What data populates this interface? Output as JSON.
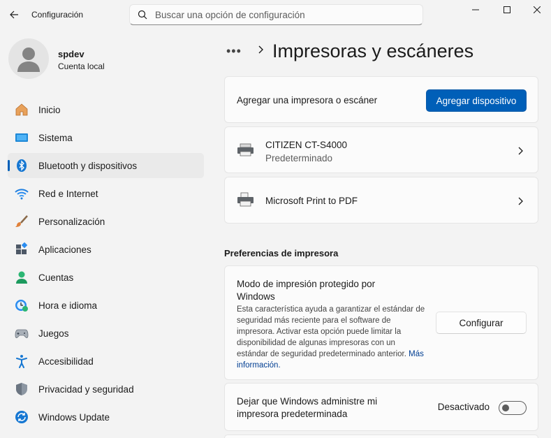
{
  "window": {
    "title": "Configuración",
    "search_placeholder": "Buscar una opción de configuración"
  },
  "profile": {
    "name": "spdev",
    "account_type": "Cuenta local"
  },
  "sidebar": {
    "items": [
      {
        "label": "Inicio",
        "icon": "home-icon"
      },
      {
        "label": "Sistema",
        "icon": "system-icon"
      },
      {
        "label": "Bluetooth y dispositivos",
        "icon": "bluetooth-icon",
        "active": true
      },
      {
        "label": "Red e Internet",
        "icon": "wifi-icon"
      },
      {
        "label": "Personalización",
        "icon": "brush-icon"
      },
      {
        "label": "Aplicaciones",
        "icon": "apps-icon"
      },
      {
        "label": "Cuentas",
        "icon": "account-icon"
      },
      {
        "label": "Hora e idioma",
        "icon": "time-language-icon"
      },
      {
        "label": "Juegos",
        "icon": "gamepad-icon"
      },
      {
        "label": "Accesibilidad",
        "icon": "accessibility-icon"
      },
      {
        "label": "Privacidad y seguridad",
        "icon": "shield-icon"
      },
      {
        "label": "Windows Update",
        "icon": "update-icon"
      }
    ]
  },
  "breadcrumb": {
    "more": "•••",
    "title": "Impresoras y escáneres"
  },
  "add_device": {
    "label": "Agregar una impresora o escáner",
    "button": "Agregar dispositivo"
  },
  "printers": [
    {
      "name": "CITIZEN CT-S4000",
      "status": "Predeterminado"
    },
    {
      "name": "Microsoft Print to PDF",
      "status": ""
    }
  ],
  "preferences": {
    "section_title": "Preferencias de impresora",
    "protected_mode": {
      "title": "Modo de impresión protegido por Windows",
      "description": "Esta característica ayuda a garantizar el estándar de seguridad más reciente para el software de impresora. Activar esta opción puede limitar la disponibilidad de algunas impresoras con un estándar de seguridad predeterminado anterior.",
      "link": "Más información.",
      "button": "Configurar"
    },
    "default_printer": {
      "title": "Dejar que Windows administre mi impresora predeterminada",
      "state": "Desactivado",
      "enabled": false
    }
  },
  "colors": {
    "accent": "#005fb8",
    "background": "#f3f3f3",
    "card": "#fbfbfb"
  }
}
